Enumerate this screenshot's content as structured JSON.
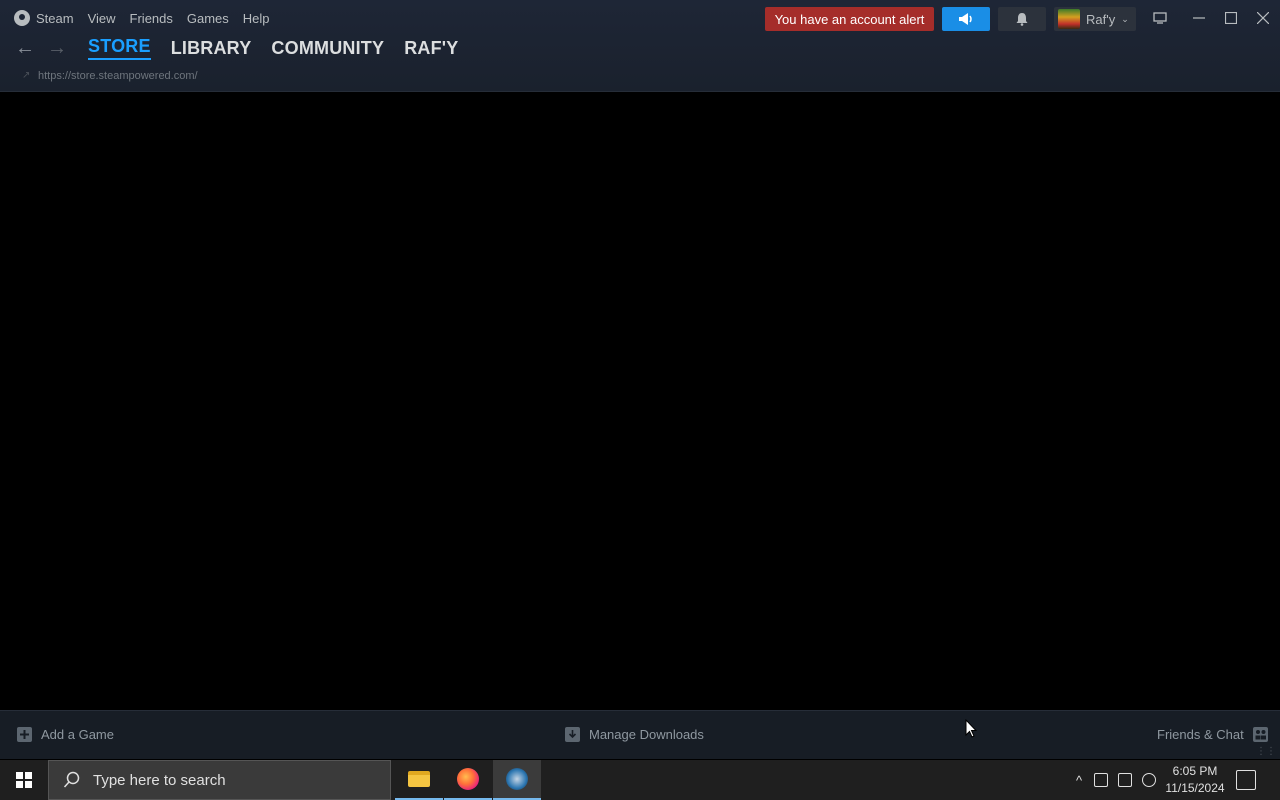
{
  "menu": {
    "steam": "Steam",
    "view": "View",
    "friends": "Friends",
    "games": "Games",
    "help": "Help"
  },
  "header": {
    "alert_label": "You have an account alert",
    "username": "Raf'y"
  },
  "nav": {
    "tabs": [
      "STORE",
      "LIBRARY",
      "COMMUNITY",
      "RAF'Y"
    ],
    "active_tab": "STORE",
    "url": "https://store.steampowered.com/"
  },
  "bottom_bar": {
    "add_game": "Add a Game",
    "manage_downloads": "Manage Downloads",
    "friends_chat": "Friends & Chat"
  },
  "taskbar": {
    "search_placeholder": "Type here to search",
    "time": "6:05 PM",
    "date": "11/15/2024",
    "apps": [
      "file-explorer",
      "firefox",
      "steam"
    ]
  },
  "colors": {
    "accent_blue": "#1a9fff",
    "alert_red": "#a52d2a",
    "announce_blue": "#1a8ee6",
    "header_bg": "#1e2636"
  },
  "icons": [
    "steam-logo-icon",
    "megaphone-icon",
    "bell-icon",
    "big-picture-icon",
    "minimize-icon",
    "maximize-icon",
    "close-icon",
    "back-arrow-icon",
    "forward-arrow-icon",
    "lock-icon",
    "add-icon",
    "download-icon",
    "friends-icon",
    "windows-logo-icon",
    "search-icon",
    "chevron-up-icon",
    "notification-icon"
  ]
}
